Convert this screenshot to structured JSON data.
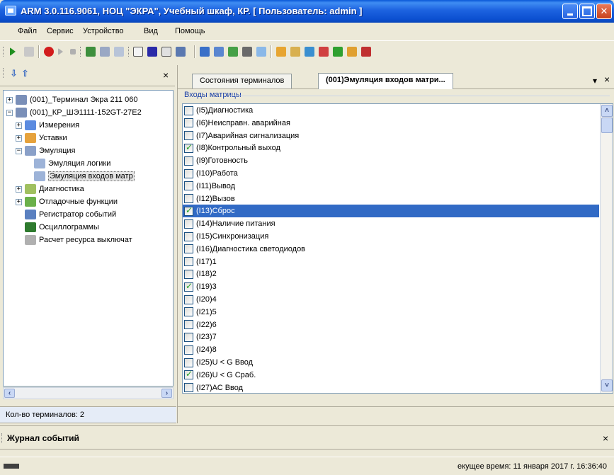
{
  "window": {
    "title": "ARM 3.0.116.9061, НОЦ \"ЭКРА\", Учебный шкаф, КР. [ Пользователь: admin ]"
  },
  "menu": [
    "Файл",
    "Сервис",
    "Устройство",
    "Вид",
    "Помощь"
  ],
  "left_pane": {
    "tree": [
      {
        "label": "(001)_Терминал Экра 211 060",
        "level": 0,
        "expander": "+",
        "icon": "terminal-icon"
      },
      {
        "label": "(001)_КР_ШЭ1111-152GT-27E2",
        "level": 0,
        "expander": "−",
        "icon": "terminal-icon"
      },
      {
        "label": "Измерения",
        "level": 1,
        "expander": "+",
        "icon": "measurements-icon"
      },
      {
        "label": "Уставки",
        "level": 1,
        "expander": "+",
        "icon": "settings-folder-icon"
      },
      {
        "label": "Эмуляция",
        "level": 1,
        "expander": "−",
        "icon": "emulation-icon"
      },
      {
        "label": "Эмуляция логики",
        "level": 2,
        "icon": "grid-icon"
      },
      {
        "label": "Эмуляция входов матр",
        "level": 2,
        "icon": "grid-icon",
        "selected": true
      },
      {
        "label": "Диагностика",
        "level": 1,
        "expander": "+",
        "icon": "diagnostics-icon"
      },
      {
        "label": "Отладочные функции",
        "level": 1,
        "expander": "+",
        "icon": "debug-icon"
      },
      {
        "label": "Регистратор событий",
        "level": 1,
        "icon": "event-recorder-icon"
      },
      {
        "label": "Осциллограммы",
        "level": 1,
        "icon": "oscillogram-icon"
      },
      {
        "label": "Расчет ресурса выключат",
        "level": 1,
        "icon": "calculator-icon"
      }
    ],
    "status": "Кол-во терминалов: 2"
  },
  "tabs": [
    {
      "label": "Состояния терминалов",
      "active": false
    },
    {
      "label": "(001)Эмуляция входов матри...",
      "active": true
    }
  ],
  "matrix": {
    "group_label": "Входы матрицы",
    "items": [
      {
        "label": "(I5)Диагностика",
        "checked": false
      },
      {
        "label": "(I6)Неисправн. аварийная",
        "checked": false
      },
      {
        "label": "(I7)Аварийная сигнализация",
        "checked": false
      },
      {
        "label": "(I8)Контрольный выход",
        "checked": true
      },
      {
        "label": "(I9)Готовность",
        "checked": false
      },
      {
        "label": "(I10)Работа",
        "checked": false
      },
      {
        "label": "(I11)Вывод",
        "checked": false
      },
      {
        "label": "(I12)Вызов",
        "checked": false
      },
      {
        "label": "(I13)Сброс",
        "checked": true,
        "selected": true
      },
      {
        "label": "(I14)Наличие питания",
        "checked": false
      },
      {
        "label": "(I15)Синхронизация",
        "checked": false
      },
      {
        "label": "(I16)Диагностика светодиодов",
        "checked": false
      },
      {
        "label": "(I17)1",
        "checked": false
      },
      {
        "label": "(I18)2",
        "checked": false
      },
      {
        "label": "(I19)3",
        "checked": true
      },
      {
        "label": "(I20)4",
        "checked": false
      },
      {
        "label": "(I21)5",
        "checked": false
      },
      {
        "label": "(I22)6",
        "checked": false
      },
      {
        "label": "(I23)7",
        "checked": false
      },
      {
        "label": "(I24)8",
        "checked": false
      },
      {
        "label": "(I25)U < G Ввод",
        "checked": false
      },
      {
        "label": "(I26)U < G Сраб.",
        "checked": true
      },
      {
        "label": "(I27)АС Ввод",
        "checked": false
      }
    ]
  },
  "event_log": {
    "title": "Журнал событий"
  },
  "status_bar": {
    "time_text": "екущее время: 11 января 2017 г. 16:36:40"
  },
  "colors": {
    "selection": "#316ac5",
    "titlebar": "#0b4fd0",
    "group_label": "#1a3fa8"
  }
}
